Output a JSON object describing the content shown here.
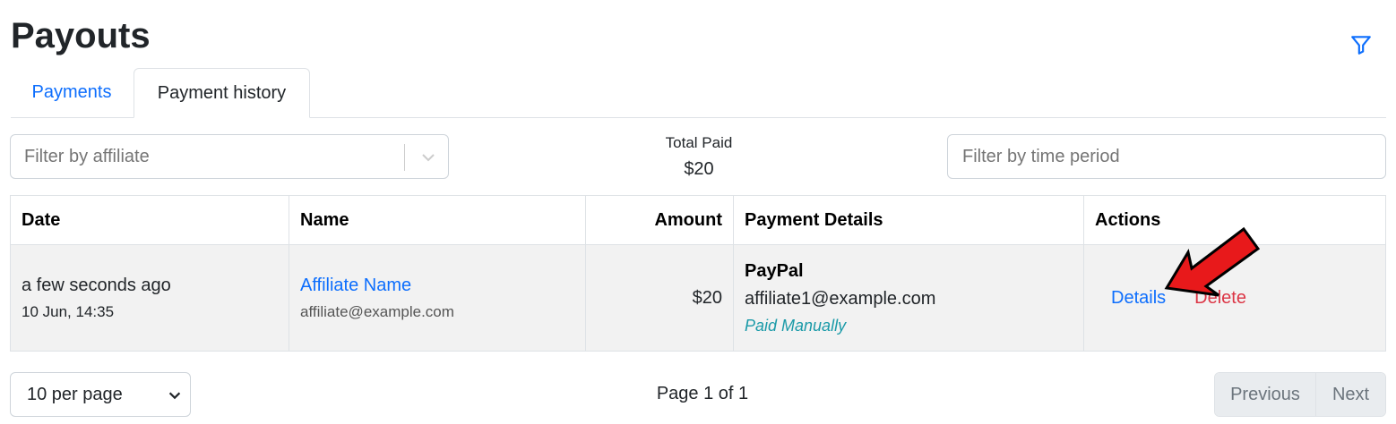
{
  "page": {
    "title": "Payouts"
  },
  "icons": {
    "filter": "filter-icon",
    "chevron": "chevron-down-icon",
    "arrow": "red-arrow-annotation"
  },
  "colors": {
    "link": "#0d6efd",
    "danger": "#dc3545",
    "info": "#1a9aa8",
    "arrow": "#e8191b"
  },
  "tabs": [
    {
      "label": "Payments",
      "active": false
    },
    {
      "label": "Payment history",
      "active": true
    }
  ],
  "filters": {
    "affiliate_placeholder": "Filter by affiliate",
    "time_placeholder": "Filter by time period"
  },
  "summary": {
    "total_label": "Total Paid",
    "total_value": "$20"
  },
  "table": {
    "headers": {
      "date": "Date",
      "name": "Name",
      "amount": "Amount",
      "details": "Payment Details",
      "actions": "Actions"
    },
    "rows": [
      {
        "date_relative": "a few seconds ago",
        "date_absolute": "10 Jun, 14:35",
        "affiliate_name": "Affiliate Name",
        "affiliate_email": "affiliate@example.com",
        "amount": "$20",
        "method": "PayPal",
        "payment_email": "affiliate1@example.com",
        "note": "Paid Manually",
        "action_details": "Details",
        "action_delete": "Delete"
      }
    ]
  },
  "pagination": {
    "per_page": "10 per page",
    "page_info": "Page 1 of 1",
    "previous": "Previous",
    "next": "Next"
  }
}
